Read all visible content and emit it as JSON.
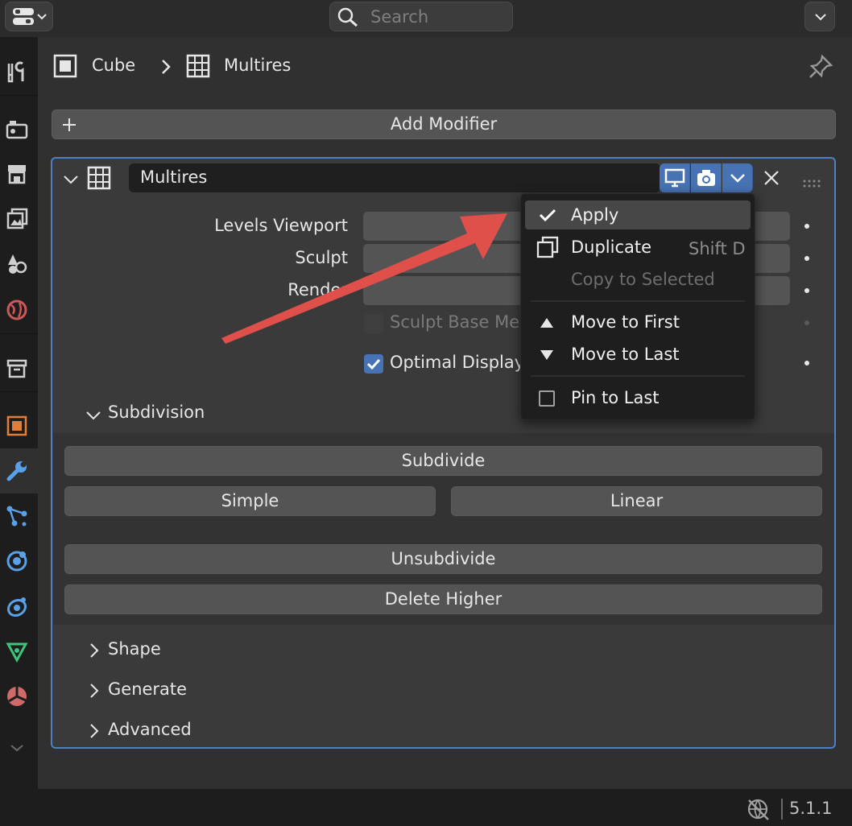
{
  "search": {
    "placeholder": "Search"
  },
  "breadcrumb": {
    "object": "Cube",
    "modifier": "Multires"
  },
  "add_modifier": {
    "label": "Add Modifier"
  },
  "modifier": {
    "name": "Multires",
    "props": {
      "levels_viewport": "Levels Viewport",
      "sculpt": "Sculpt",
      "render": "Render",
      "sculpt_base_mesh": "Sculpt Base Mes",
      "optimal_display": "Optimal Display"
    },
    "subdivision": {
      "title": "Subdivision",
      "subdivide": "Subdivide",
      "simple": "Simple",
      "linear": "Linear",
      "unsubdivide": "Unsubdivide",
      "delete_higher": "Delete Higher"
    },
    "sections": [
      "Shape",
      "Generate",
      "Advanced"
    ]
  },
  "menu": {
    "apply": "Apply",
    "duplicate": "Duplicate",
    "duplicate_shortcut": "Shift D",
    "copy_to_selected": "Copy to Selected",
    "move_to_first": "Move to First",
    "move_to_last": "Move to Last",
    "pin_to_last": "Pin to Last"
  },
  "status": {
    "version": "5.1.1"
  },
  "colors": {
    "accent": "#4772b3",
    "arrow": "#e0504a",
    "panel_border": "#4f7fc2"
  }
}
